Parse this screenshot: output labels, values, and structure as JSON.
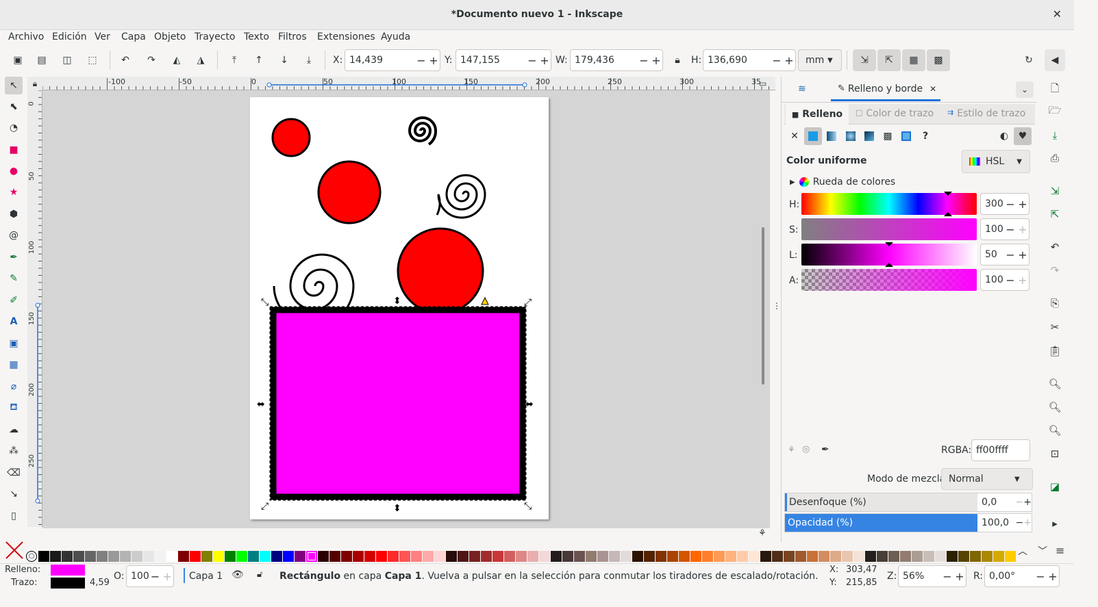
{
  "window": {
    "title": "*Documento nuevo 1 - Inkscape",
    "close": "✕"
  },
  "menu": [
    "Archivo",
    "Edición",
    "Ver",
    "Capa",
    "Objeto",
    "Trayecto",
    "Texto",
    "Filtros",
    "Extensiones",
    "Ayuda"
  ],
  "toolbar": {
    "x_label": "X:",
    "x_value": "14,439",
    "y_label": "Y:",
    "y_value": "147,155",
    "w_label": "W:",
    "w_value": "179,436",
    "h_label": "H:",
    "h_value": "136,690",
    "unit": "mm",
    "minus": "−",
    "plus": "+"
  },
  "ruler_h": [
    "-100",
    "-50",
    "0",
    "50",
    "100",
    "150",
    "200",
    "250",
    "300",
    "35"
  ],
  "ruler_v": [
    "0",
    "50",
    "100",
    "150",
    "200",
    "250"
  ],
  "canvas": {
    "fill_color": "#ff00ff",
    "circle_color": "#ff0000"
  },
  "panel": {
    "tab_label": "Relleno y borde",
    "subtabs": [
      "Relleno",
      "Color de trazo",
      "Estilo de trazo"
    ],
    "paint_title": "Color uniforme",
    "mode": "HSL",
    "wheel_label": "Rueda de colores",
    "sliders": [
      {
        "label": "H:",
        "value": "300"
      },
      {
        "label": "S:",
        "value": "100"
      },
      {
        "label": "L:",
        "value": "50"
      },
      {
        "label": "A:",
        "value": "100"
      }
    ],
    "rgba_label": "RGBA:",
    "rgba_value": "ff00ffff",
    "blend_label": "Modo de mezcla:",
    "blend_value": "Normal",
    "blur_label": "Desenfoque (%)",
    "blur_value": "0,0",
    "opacity_label": "Opacidad (%)",
    "opacity_value": "100,0",
    "help": "?"
  },
  "status": {
    "fill_label": "Relleno:",
    "stroke_label": "Trazo:",
    "fill_color": "#ff00ff",
    "stroke_color": "#000000",
    "stroke_width": "4,59",
    "o_label": "O:",
    "o_value": "100",
    "layer": "Capa 1",
    "msg_obj": "Rectángulo",
    "msg_mid": " en capa ",
    "msg_layer": "Capa 1",
    "msg_rest": ". Vuelva a pulsar en la selección para conmutar los tiradores de escalado/rotación.",
    "x_label": "X:",
    "x_value": "303,47",
    "y_label": "Y:",
    "y_value": "215,85",
    "z_label": "Z:",
    "z_value": "56%",
    "r_label": "R:",
    "r_value": "0,00°"
  },
  "palette_colors": [
    "#000000",
    "#1a1a1a",
    "#333333",
    "#4d4d4d",
    "#666666",
    "#808080",
    "#999999",
    "#b3b3b3",
    "#cccccc",
    "#e6e6e6",
    "#f2f2f2",
    "#ffffff",
    "#800000",
    "#ff0000",
    "#808000",
    "#ffff00",
    "#008000",
    "#00ff00",
    "#008080",
    "#00ffff",
    "#000080",
    "#0000ff",
    "#800080",
    "#ff00ff",
    "#2b0000",
    "#550000",
    "#800000",
    "#aa0000",
    "#d40000",
    "#ff0000",
    "#ff2a2a",
    "#ff5555",
    "#ff8080",
    "#ffaaaa",
    "#ffd5d5",
    "#280b0b",
    "#501616",
    "#782121",
    "#a02c2c",
    "#c83737",
    "#d35f5f",
    "#de8787",
    "#e9afaf",
    "#f4d7d7",
    "#241c1c",
    "#483737",
    "#6c5353",
    "#917c6f",
    "#ac9393",
    "#c8b7b7",
    "#e3dbdb",
    "#2b1100",
    "#552200",
    "#803300",
    "#aa4400",
    "#d45500",
    "#ff6600",
    "#ff7f2a",
    "#ff9955",
    "#ffb380",
    "#ffccaa",
    "#ffe6d5",
    "#28170b",
    "#502d16",
    "#784421",
    "#a05a2c",
    "#c87137",
    "#d38d5f",
    "#deaa87",
    "#e9c6af",
    "#f4e3d7",
    "#241f1c",
    "#483e37",
    "#6c5d53",
    "#917c6f",
    "#ac9d93",
    "#c8beb7",
    "#e3dedb",
    "#2b2200",
    "#554400",
    "#806600",
    "#aa8800",
    "#d4aa00",
    "#ffcc00"
  ]
}
